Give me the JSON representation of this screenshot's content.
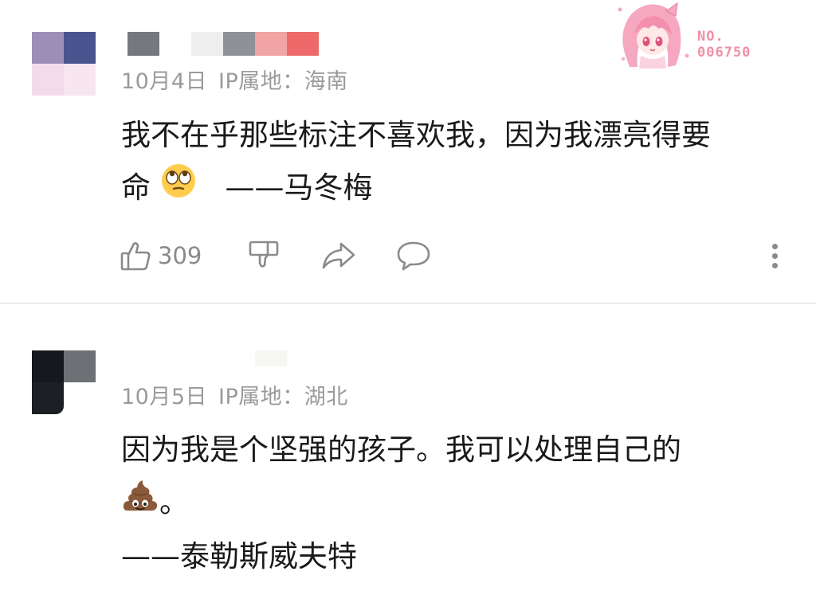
{
  "comments": [
    {
      "date": "10月4日",
      "ip_label": "IP属地：",
      "ip_region": "海南",
      "text_line1": "我不在乎那些标注不喜欢我，因为我漂亮得要",
      "text_line2_prefix": "命",
      "text_line2_suffix": "——马冬梅",
      "emoji": "rolling-eyes-emoji",
      "likes": "309"
    },
    {
      "date": "10月5日",
      "ip_label": "IP属地：",
      "ip_region": "湖北",
      "text_line1": "因为我是个坚强的孩子。我可以处理自己的",
      "text_line2_suffix": "。",
      "text_line3": "——泰勒斯威夫特",
      "emoji": "poop-emoji"
    }
  ],
  "badge": {
    "number_label": "NO.",
    "number_value": "006750"
  },
  "colors": {
    "meta_text": "#9a9a9a",
    "body_text": "#1a1a1a",
    "icon": "#8a8a8a",
    "divider": "#ececec",
    "badge_pink": "#f08fa8"
  }
}
